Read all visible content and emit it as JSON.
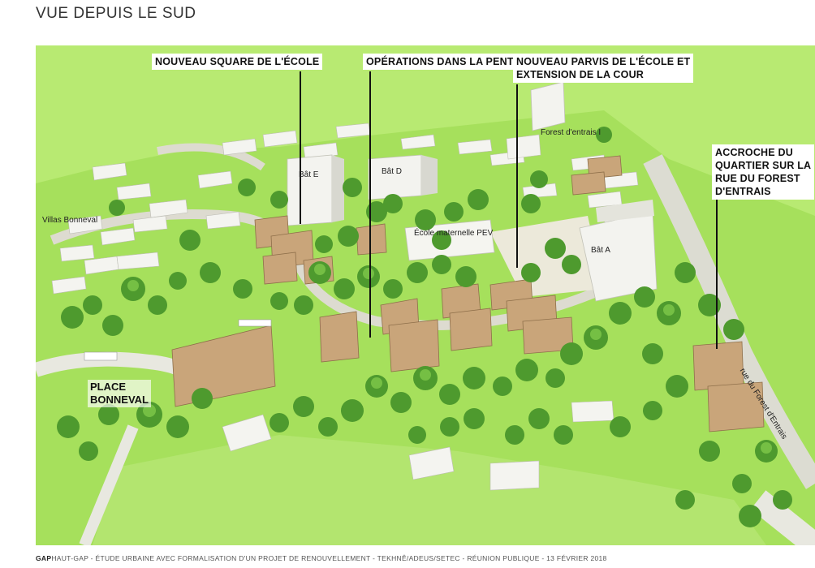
{
  "title": "VUE DEPUIS LE SUD",
  "callouts": {
    "square": "NOUVEAU SQUARE DE L'ÉCOLE",
    "pente": "OPÉRATIONS DANS LA PENTE",
    "parvis_1": "NOUVEAU PARVIS DE L'ÉCOLE ET",
    "parvis_2": "EXTENSION DE LA COUR",
    "accroche_1": "ACCROCHE DU",
    "accroche_2": "QUARTIER SUR LA",
    "accroche_3": "RUE DU FOREST",
    "accroche_4": "D'ENTRAIS"
  },
  "labels": {
    "bat_e": "Bât E",
    "bat_d": "Bât D",
    "bat_a": "Bât A",
    "forest_entrais": "Forest d'entrais I",
    "villas": "Villas Bonneval",
    "ecole": "École maternelle PEV",
    "rue": "rue du Forest d'Entrais"
  },
  "place": {
    "line1": "PLACE",
    "line2": "BONNEVAL"
  },
  "footer": {
    "brand": "GAP",
    "text": "HAUT-GAP - ÉTUDE URBAINE AVEC FORMALISATION D'UN PROJET DE RENOUVELLEMENT - TEKHNÊ/ADEUS/SETEC - RÉUNION PUBLIQUE - 13 FÉVRIER 2018"
  },
  "colors": {
    "grass": "#a6e05c",
    "grass_light": "#c4ec8a",
    "tree": "#4e9a2e",
    "wood": "#c9a57a",
    "white_building": "#f2f2f2"
  }
}
